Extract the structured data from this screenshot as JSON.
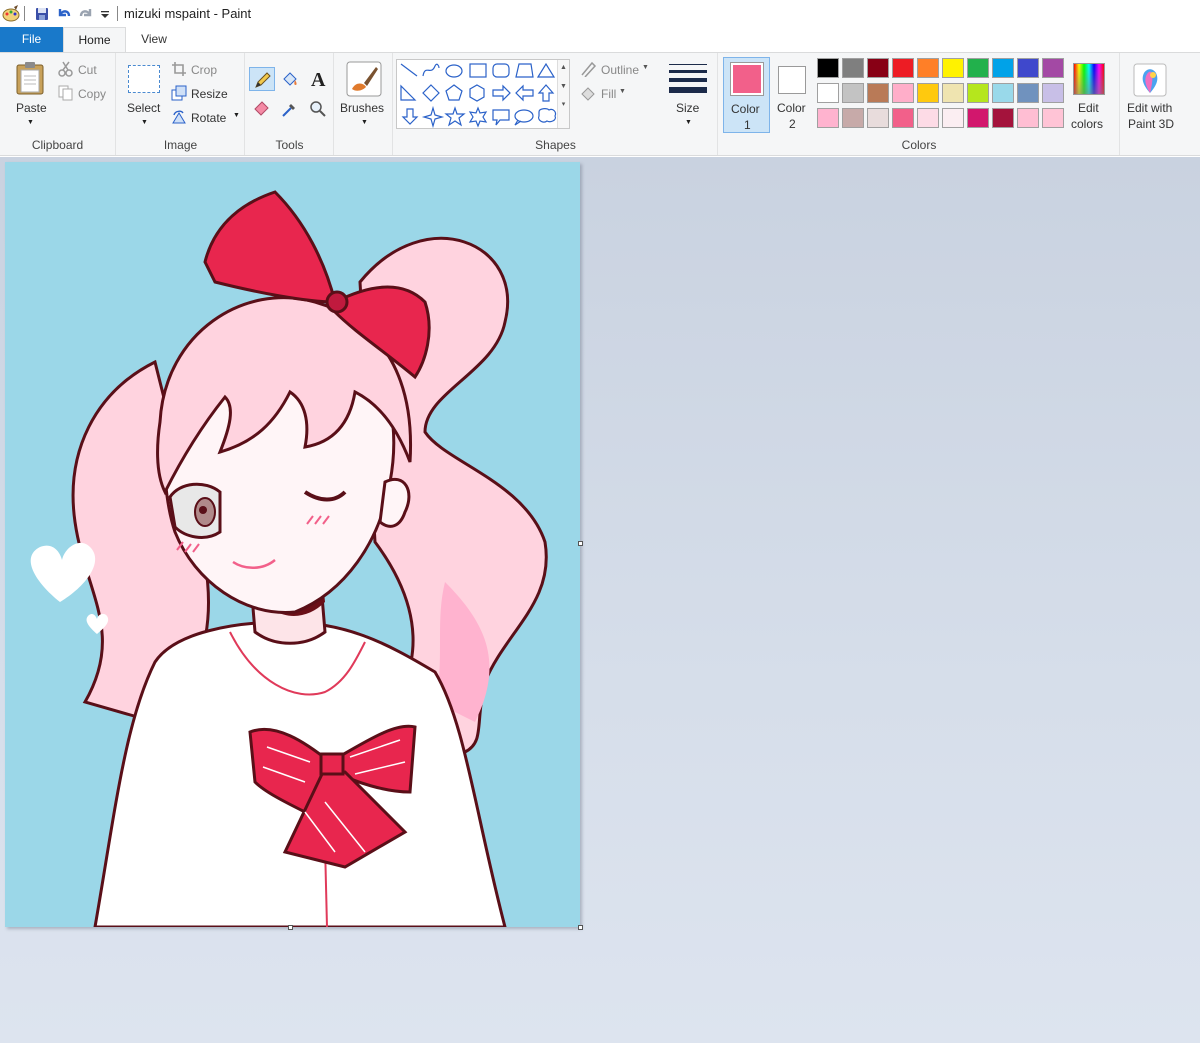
{
  "app": {
    "title": "mizuki mspaint - Paint"
  },
  "quick_access": {
    "items": [
      "paint-app-icon",
      "save-icon",
      "undo-icon",
      "redo-icon",
      "customize-icon"
    ]
  },
  "tabs": [
    {
      "label": "File",
      "active": false
    },
    {
      "label": "Home",
      "active": true
    },
    {
      "label": "View",
      "active": false
    }
  ],
  "clipboard": {
    "paste_label": "Paste",
    "cut_label": "Cut",
    "copy_label": "Copy",
    "group_label": "Clipboard"
  },
  "image": {
    "select_label": "Select",
    "crop_label": "Crop",
    "resize_label": "Resize",
    "rotate_label": "Rotate",
    "group_label": "Image"
  },
  "tools": {
    "group_label": "Tools",
    "items": [
      "pencil-icon",
      "fill-bucket-icon",
      "text-icon",
      "eraser-icon",
      "color-picker-icon",
      "magnifier-icon"
    ]
  },
  "brushes": {
    "label": "Brushes"
  },
  "shapes": {
    "group_label": "Shapes",
    "outline_label": "Outline",
    "fill_label": "Fill"
  },
  "size": {
    "label": "Size"
  },
  "colors": {
    "group_label": "Colors",
    "color1_label": "Color",
    "color1_num": "1",
    "color1_value": "#f2608a",
    "color2_label": "Color",
    "color2_num": "2",
    "color2_value": "#ffffff",
    "edit_colors_label1": "Edit",
    "edit_colors_label2": "colors",
    "edit_3d_label1": "Edit with",
    "edit_3d_label2": "Paint 3D",
    "palette_row1": [
      "#000000",
      "#7f7f7f",
      "#880015",
      "#ed1c24",
      "#ff7f27",
      "#fff200",
      "#22b14c",
      "#00a2e8",
      "#3f48cc",
      "#a349a4"
    ],
    "palette_row2": [
      "#ffffff",
      "#c3c3c3",
      "#b97a57",
      "#ffaec9",
      "#ffc90e",
      "#efe4b0",
      "#b5e61d",
      "#99d9ea",
      "#7092be",
      "#c8bfe7"
    ],
    "palette_row3": [
      "#ffb3cf",
      "#c7aaa9",
      "#e8dcdc",
      "#f2608a",
      "#fddbe6",
      "#fbeef2",
      "#d2176d",
      "#a4133c",
      "#ffbed3",
      "#ffc4d6"
    ]
  },
  "canvas": {
    "background": "#9bd7e8"
  }
}
